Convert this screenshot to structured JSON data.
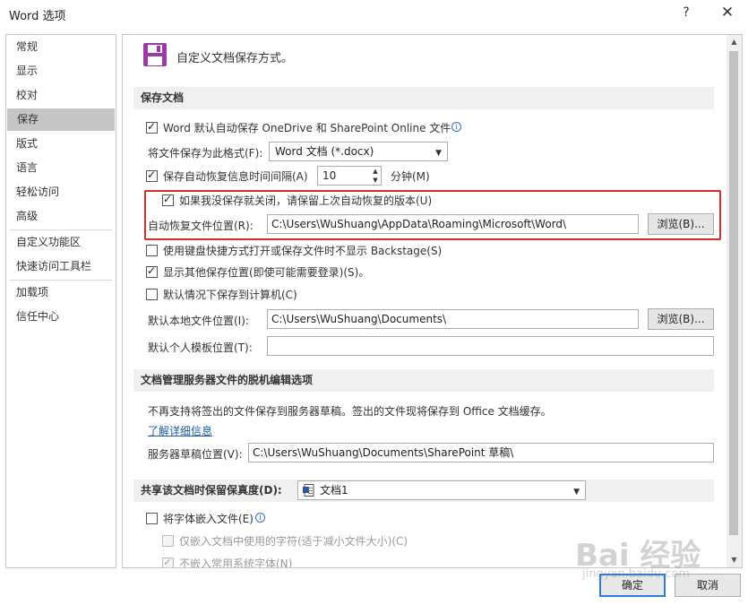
{
  "window": {
    "title": "Word 选项",
    "help": "?",
    "close": "✕"
  },
  "sidebar": {
    "items": [
      {
        "label": "常规"
      },
      {
        "label": "显示"
      },
      {
        "label": "校对"
      },
      {
        "label": "保存",
        "active": true
      },
      {
        "label": "版式"
      },
      {
        "label": "语言"
      },
      {
        "label": "轻松访问"
      },
      {
        "label": "高级"
      },
      {
        "label": "自定义功能区"
      },
      {
        "label": "快速访问工具栏"
      },
      {
        "label": "加载项"
      },
      {
        "label": "信任中心"
      }
    ]
  },
  "header": {
    "title": "自定义文档保存方式。",
    "icon": "floppy-disk-icon"
  },
  "save_section": {
    "title": "保存文档",
    "onedrive_autosave": {
      "label": "Word 默认自动保存 OneDrive 和 SharePoint Online 文件",
      "checked": true
    },
    "format": {
      "label": "将文件保存为此格式(F):",
      "value": "Word 文档 (*.docx)"
    },
    "autorecover": {
      "label": "保存自动恢复信息时间间隔(A)",
      "value": "10",
      "unit": "分钟(M)",
      "checked": true
    },
    "keep_last": {
      "label": "如果我没保存就关闭，请保留上次自动恢复的版本(U)",
      "checked": true
    },
    "autorecover_location": {
      "label": "自动恢复文件位置(R):",
      "value": "C:\\Users\\WuShuang\\AppData\\Roaming\\Microsoft\\Word\\",
      "browse": "浏览(B)..."
    },
    "no_backstage": {
      "label": "使用键盘快捷方式打开或保存文件时不显示 Backstage(S)",
      "checked": false
    },
    "show_additional": {
      "label": "显示其他保存位置(即使可能需要登录)(S)。",
      "checked": true
    },
    "save_to_computer": {
      "label": "默认情况下保存到计算机(C)",
      "checked": false
    },
    "default_local": {
      "label": "默认本地文件位置(I):",
      "value": "C:\\Users\\WuShuang\\Documents\\",
      "browse": "浏览(B)..."
    },
    "template_location": {
      "label": "默认个人模板位置(T):",
      "value": ""
    }
  },
  "offline_section": {
    "title": "文档管理服务器文件的脱机编辑选项",
    "description": "不再支持将签出的文件保存到服务器草稿。签出的文件现将保存到 Office 文档缓存。",
    "learn_more": "了解详细信息",
    "drafts": {
      "label": "服务器草稿位置(V):",
      "value": "C:\\Users\\WuShuang\\Documents\\SharePoint 草稿\\"
    }
  },
  "fidelity_section": {
    "title": "共享该文档时保留保真度(D):",
    "document": "文档1",
    "embed_fonts": {
      "label": "将字体嵌入文件(E)",
      "checked": false
    },
    "embed_used_only": {
      "label": "仅嵌入文档中使用的字符(适于减小文件大小)(C)",
      "checked": false
    },
    "no_common_fonts": {
      "label": "不嵌入常用系统字体(N)",
      "checked": true
    }
  },
  "footer": {
    "ok": "确定",
    "cancel": "取消"
  },
  "watermark": {
    "text": "Bai 经验",
    "sub": "jingyan.baidu.com"
  },
  "colors": {
    "highlight": "#d0302e",
    "section_bg": "#f0f0f0",
    "active_nav": "#c5c5c5",
    "link": "#1a5ca8"
  }
}
